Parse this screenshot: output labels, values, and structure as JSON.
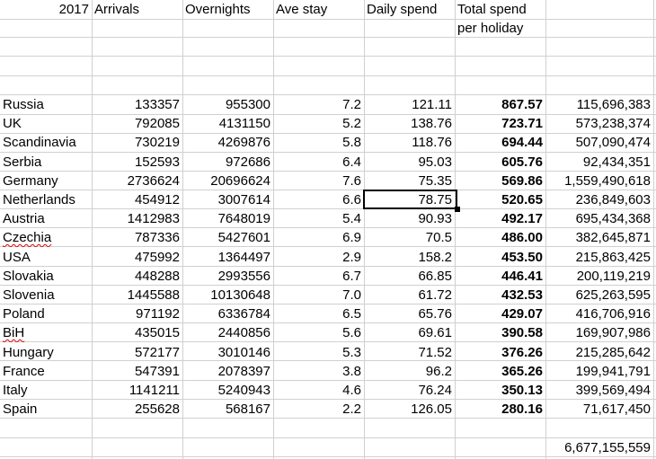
{
  "headers": {
    "year": "2017",
    "arrivals": "Arrivals",
    "overnights": "Overnights",
    "ave_stay": "Ave stay",
    "daily_spend": "Daily spend",
    "total_spend_1": "Total spend",
    "total_spend_2": "per holiday"
  },
  "rows": [
    {
      "country": "Russia",
      "arrivals": "133357",
      "overnights": "955300",
      "ave_stay": "7.2",
      "daily_spend": "121.11",
      "total_per_holiday": "867.57",
      "total_spend": "115,696,383"
    },
    {
      "country": "UK",
      "arrivals": "792085",
      "overnights": "4131150",
      "ave_stay": "5.2",
      "daily_spend": "138.76",
      "total_per_holiday": "723.71",
      "total_spend": "573,238,374"
    },
    {
      "country": "Scandinavia",
      "arrivals": "730219",
      "overnights": "4269876",
      "ave_stay": "5.8",
      "daily_spend": "118.76",
      "total_per_holiday": "694.44",
      "total_spend": "507,090,474"
    },
    {
      "country": "Serbia",
      "arrivals": "152593",
      "overnights": "972686",
      "ave_stay": "6.4",
      "daily_spend": "95.03",
      "total_per_holiday": "605.76",
      "total_spend": "92,434,351"
    },
    {
      "country": "Germany",
      "arrivals": "2736624",
      "overnights": "20696624",
      "ave_stay": "7.6",
      "daily_spend": "75.35",
      "total_per_holiday": "569.86",
      "total_spend": "1,559,490,618"
    },
    {
      "country": "Netherlands",
      "arrivals": "454912",
      "overnights": "3007614",
      "ave_stay": "6.6",
      "daily_spend": "78.75",
      "total_per_holiday": "520.65",
      "total_spend": "236,849,603"
    },
    {
      "country": "Austria",
      "arrivals": "1412983",
      "overnights": "7648019",
      "ave_stay": "5.4",
      "daily_spend": "90.93",
      "total_per_holiday": "492.17",
      "total_spend": "695,434,368"
    },
    {
      "country": "Czechia",
      "arrivals": "787336",
      "overnights": "5427601",
      "ave_stay": "6.9",
      "daily_spend": "70.5",
      "total_per_holiday": "486.00",
      "total_spend": "382,645,871",
      "spell": true
    },
    {
      "country": "USA",
      "arrivals": "475992",
      "overnights": "1364497",
      "ave_stay": "2.9",
      "daily_spend": "158.2",
      "total_per_holiday": "453.50",
      "total_spend": "215,863,425"
    },
    {
      "country": "Slovakia",
      "arrivals": "448288",
      "overnights": "2993556",
      "ave_stay": "6.7",
      "daily_spend": "66.85",
      "total_per_holiday": "446.41",
      "total_spend": "200,119,219"
    },
    {
      "country": "Slovenia",
      "arrivals": "1445588",
      "overnights": "10130648",
      "ave_stay": "7.0",
      "daily_spend": "61.72",
      "total_per_holiday": "432.53",
      "total_spend": "625,263,595"
    },
    {
      "country": "Poland",
      "arrivals": "971192",
      "overnights": "6336784",
      "ave_stay": "6.5",
      "daily_spend": "65.76",
      "total_per_holiday": "429.07",
      "total_spend": "416,706,916"
    },
    {
      "country": "BiH",
      "arrivals": "435015",
      "overnights": "2440856",
      "ave_stay": "5.6",
      "daily_spend": "69.61",
      "total_per_holiday": "390.58",
      "total_spend": "169,907,986",
      "spell": true
    },
    {
      "country": "Hungary",
      "arrivals": "572177",
      "overnights": "3010146",
      "ave_stay": "5.3",
      "daily_spend": "71.52",
      "total_per_holiday": "376.26",
      "total_spend": "215,285,642"
    },
    {
      "country": "France",
      "arrivals": "547391",
      "overnights": "2078397",
      "ave_stay": "3.8",
      "daily_spend": "96.2",
      "total_per_holiday": "365.26",
      "total_spend": "199,941,791"
    },
    {
      "country": "Italy",
      "arrivals": "1141211",
      "overnights": "5240943",
      "ave_stay": "4.6",
      "daily_spend": "76.24",
      "total_per_holiday": "350.13",
      "total_spend": "399,569,494"
    },
    {
      "country": "Spain",
      "arrivals": "255628",
      "overnights": "568167",
      "ave_stay": "2.2",
      "daily_spend": "126.05",
      "total_per_holiday": "280.16",
      "total_spend": "71,617,450"
    }
  ],
  "grand_total": "6,677,155,559",
  "active_cell": {
    "row": "Netherlands",
    "column": "Daily spend",
    "value": "78.75"
  }
}
